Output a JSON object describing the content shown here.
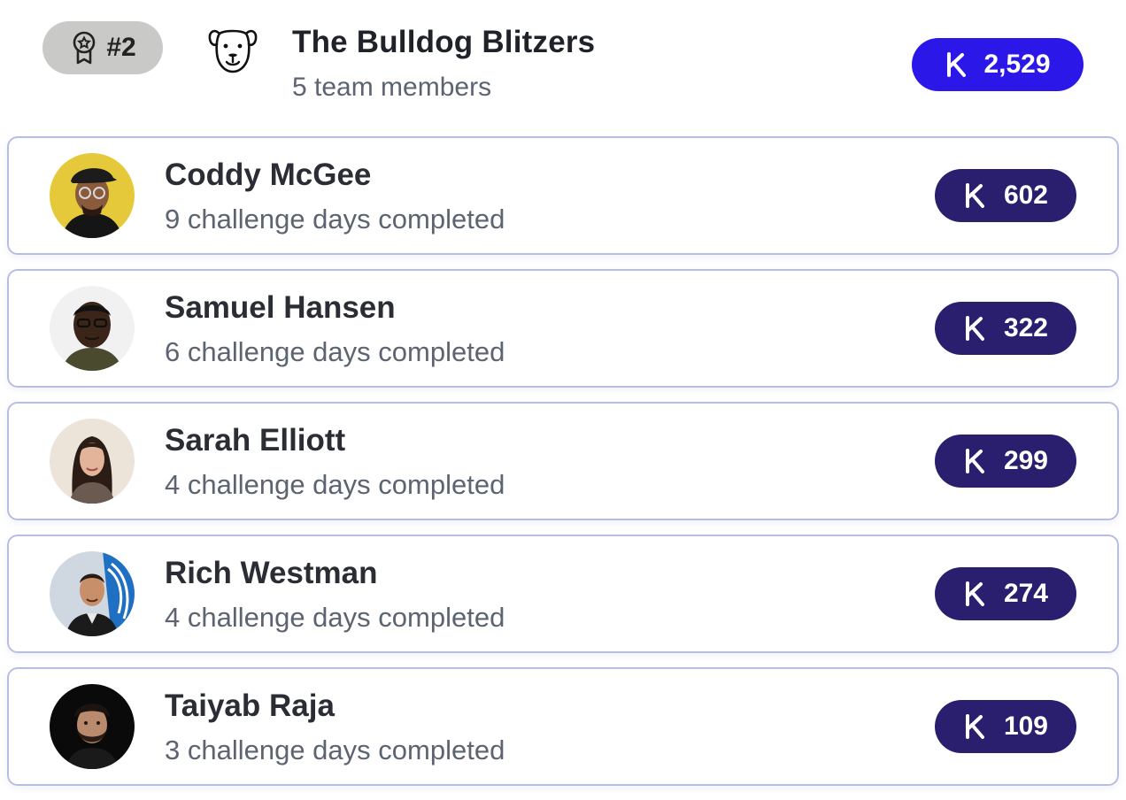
{
  "team": {
    "rank": "#2",
    "name": "The Bulldog Blitzers",
    "members_text": "5 team members",
    "score": "2,529",
    "rank_icon": "award-ribbon-icon",
    "team_icon": "bulldog-icon",
    "score_icon": "k-points-icon",
    "colors": {
      "rank_pill": "#c9cac7",
      "team_score": "#2b17e8",
      "member_score": "#2a1f6e",
      "card_border": "#b9bde2"
    }
  },
  "members": [
    {
      "name": "Coddy McGee",
      "subtitle": "9 challenge days completed",
      "score": "602"
    },
    {
      "name": "Samuel Hansen",
      "subtitle": "6 challenge days completed",
      "score": "322"
    },
    {
      "name": "Sarah Elliott",
      "subtitle": "4 challenge days completed",
      "score": "299"
    },
    {
      "name": "Rich Westman",
      "subtitle": "4 challenge days completed",
      "score": "274"
    },
    {
      "name": "Taiyab Raja",
      "subtitle": "3 challenge days completed",
      "score": "109"
    }
  ]
}
